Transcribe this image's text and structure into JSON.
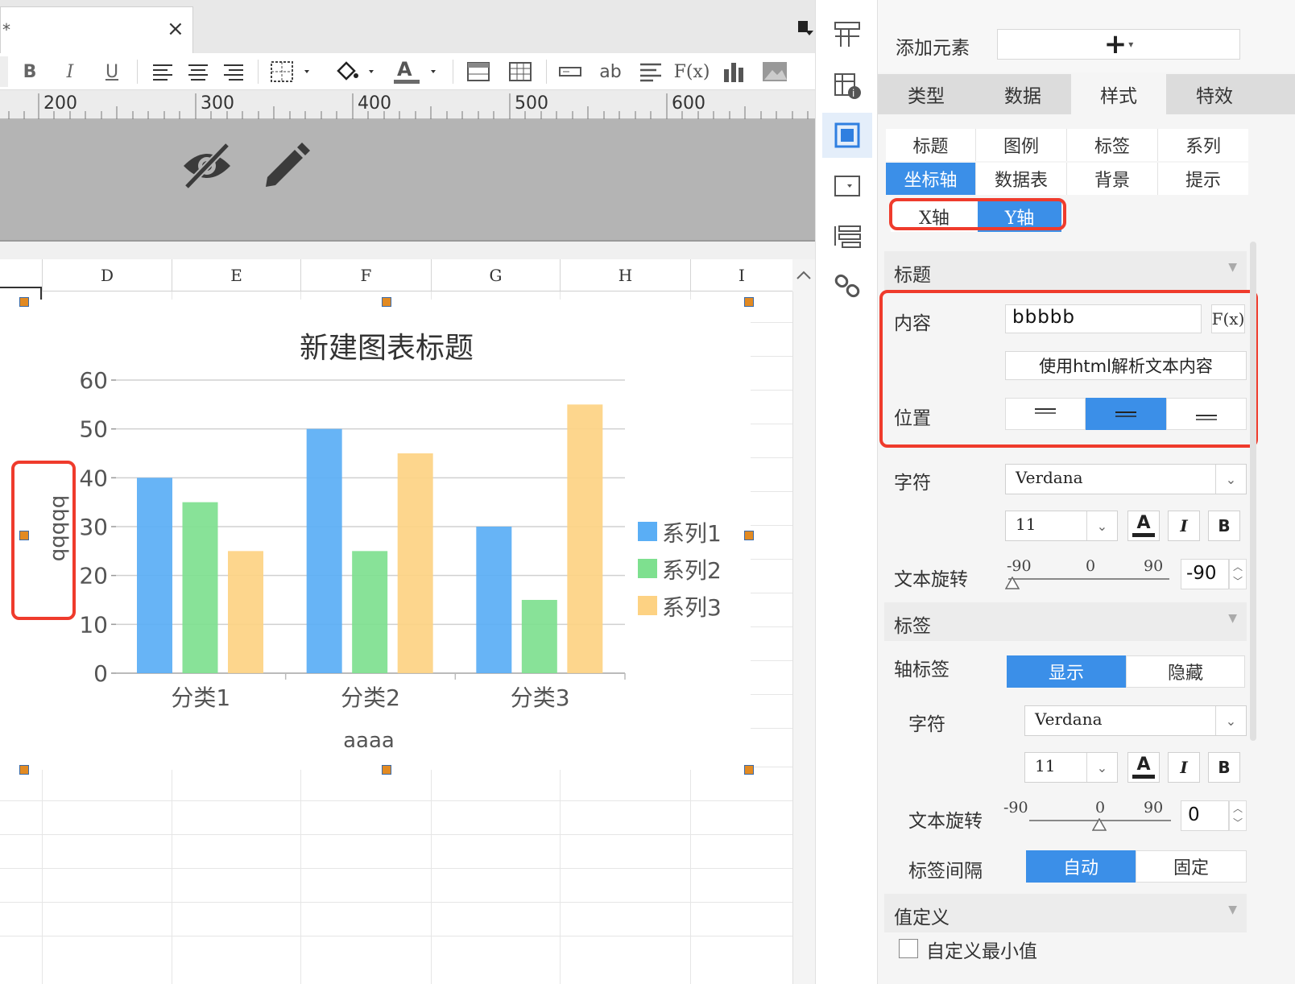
{
  "tab": {
    "star": "*",
    "close": "×"
  },
  "toolbar": {
    "bold": "B",
    "italic": "I",
    "underline": "U",
    "text_ab": "ab",
    "formula": "F(x)",
    "font_color_letter": "A"
  },
  "ruler": {
    "marks": [
      "200",
      "300",
      "400",
      "500",
      "600"
    ]
  },
  "columns": [
    "D",
    "E",
    "F",
    "G",
    "H",
    "I"
  ],
  "chart_data": {
    "type": "bar",
    "title": "新建图表标题",
    "categories": [
      "分类1",
      "分类2",
      "分类3"
    ],
    "series": [
      {
        "name": "系列1",
        "values": [
          40,
          50,
          30
        ],
        "color": "#5aaef5"
      },
      {
        "name": "系列2",
        "values": [
          35,
          25,
          15
        ],
        "color": "#7ee08f"
      },
      {
        "name": "系列3",
        "values": [
          25,
          45,
          55
        ],
        "color": "#fdd283"
      }
    ],
    "xlabel": "aaaa",
    "ylabel": "bbbbb",
    "ylim": [
      0,
      60
    ],
    "yticks": [
      "0",
      "10",
      "20",
      "30",
      "40",
      "50",
      "60"
    ],
    "grid": true,
    "legend": "right"
  },
  "panel": {
    "add_element_label": "添加元素",
    "add_element_btn": "+",
    "main_tabs": [
      "类型",
      "数据",
      "样式",
      "特效"
    ],
    "sub_tabs_row1": [
      "标题",
      "图例",
      "标签",
      "系列"
    ],
    "sub_tabs_row2": [
      "坐标轴",
      "数据表",
      "背景",
      "提示"
    ],
    "axis_x": "X轴",
    "axis_y": "Y轴",
    "title_section": "标题",
    "content_label": "内容",
    "content_value": "bbbbb",
    "fx_label": "F(x)",
    "html_parse_btn": "使用html解析文本内容",
    "position_label": "位置",
    "font_label": "字符",
    "font_value": "Verdana",
    "size_value": "11",
    "font_color_letter": "A",
    "italic": "I",
    "bold": "B",
    "rotate_label": "文本旋转",
    "rot_min": "-90",
    "rot_mid": "0",
    "rot_max": "90",
    "title_rotate_value": "-90",
    "label_section": "标签",
    "axis_label_label": "轴标签",
    "show": "显示",
    "hide": "隐藏",
    "label_font_label": "字符",
    "label_font_value": "Verdana",
    "label_size_value": "11",
    "label_rotate_label": "文本旋转",
    "label_rotate_value": "0",
    "interval_label": "标签间隔",
    "auto": "自动",
    "fixed": "固定",
    "value_def_section": "值定义",
    "custom_min_label": "自定义最小值"
  }
}
